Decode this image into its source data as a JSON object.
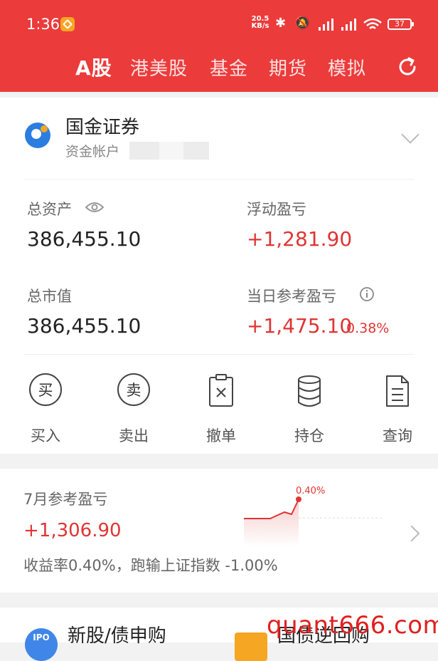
{
  "status_bar": {
    "time": "1:36",
    "net_speed_value": "20.5",
    "net_speed_unit": "KB/s",
    "battery": "37"
  },
  "tabs": [
    {
      "label": "A股",
      "active": true
    },
    {
      "label": "港美股",
      "active": false
    },
    {
      "label": "基金",
      "active": false
    },
    {
      "label": "期货",
      "active": false
    },
    {
      "label": "模拟",
      "active": false
    }
  ],
  "account": {
    "broker_name": "国金证券",
    "account_label": "资金帐户"
  },
  "summary": {
    "total_assets_label": "总资产",
    "total_assets_value": "386,455.10",
    "floating_pnl_label": "浮动盈亏",
    "floating_pnl_value": "+1,281.90",
    "market_value_label": "总市值",
    "market_value_value": "386,455.10",
    "daily_pnl_label": "当日参考盈亏",
    "daily_pnl_value": "+1,475.10",
    "daily_pnl_pct": "0.38%"
  },
  "actions": [
    {
      "label": "买入",
      "glyph": "买"
    },
    {
      "label": "卖出",
      "glyph": "卖"
    },
    {
      "label": "撤单"
    },
    {
      "label": "持仓"
    },
    {
      "label": "查询"
    }
  ],
  "month": {
    "title": "7月参考盈亏",
    "value": "+1,306.90",
    "subtitle": "收益率0.40%，跑输上证指数 -1.00%",
    "chart_label": "0.40%"
  },
  "bottom": {
    "ipo_label": "新股/债申购",
    "ipo_icon_text": "IPO",
    "repo_label": "国债逆回购"
  },
  "watermark": "quant666.com",
  "colors": {
    "header_red": "#eb3b3b",
    "gain_red": "#e03434"
  }
}
